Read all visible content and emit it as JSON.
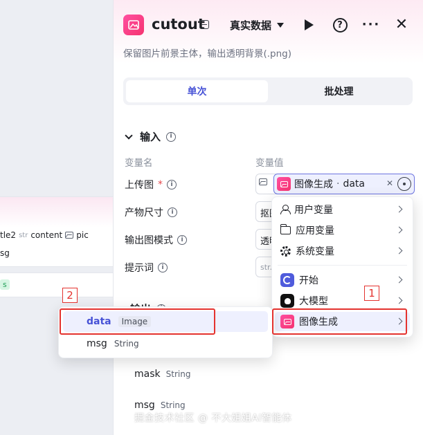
{
  "canvas": {
    "vars": [
      "tle2",
      "str",
      "content",
      "pic"
    ],
    "msg": "sg",
    "badge": "s"
  },
  "panel": {
    "title": "cutout",
    "mode": "真实数据",
    "subtitle": "保留图片前景主体，输出透明背景(.png)",
    "tabs": [
      {
        "label": "单次",
        "active": true
      },
      {
        "label": "批处理",
        "active": false
      }
    ],
    "input_section": "输入",
    "col_name": "变量名",
    "col_value": "变量值",
    "fields": [
      {
        "label": "上传图",
        "required": "*"
      },
      {
        "label": "产物尺寸",
        "stub": "抠图"
      },
      {
        "label": "输出图模式",
        "stub": "透明"
      },
      {
        "label": "提示词",
        "stub": "str."
      }
    ],
    "ref_chip": {
      "source": "图像生成",
      "sep": "·",
      "var": "data"
    },
    "output_section": "输出",
    "outputs": [
      {
        "name": "mask",
        "type": "String"
      },
      {
        "name": "msg",
        "type": "String"
      }
    ]
  },
  "menu": {
    "items": [
      {
        "label": "用户变量",
        "icon": "user-icon"
      },
      {
        "label": "应用变量",
        "icon": "folder-icon"
      },
      {
        "label": "系统变量",
        "icon": "gear-icon"
      },
      {
        "label": "开始",
        "icon": "start-node-icon"
      },
      {
        "label": "大模型",
        "icon": "llm-node-icon"
      },
      {
        "label": "图像生成",
        "icon": "image-gen-icon"
      }
    ]
  },
  "popover": {
    "rows": [
      {
        "name": "data",
        "type": "Image"
      },
      {
        "name": "msg",
        "type": "String"
      }
    ]
  },
  "annotations": {
    "one": "1",
    "two": "2"
  },
  "watermark": "掘金技术社区 @ 不大姐姐AI智能体",
  "colors": {
    "accent": "#4752d6",
    "brand_pink": "#f5336f",
    "annotation_red": "#e4322e"
  }
}
